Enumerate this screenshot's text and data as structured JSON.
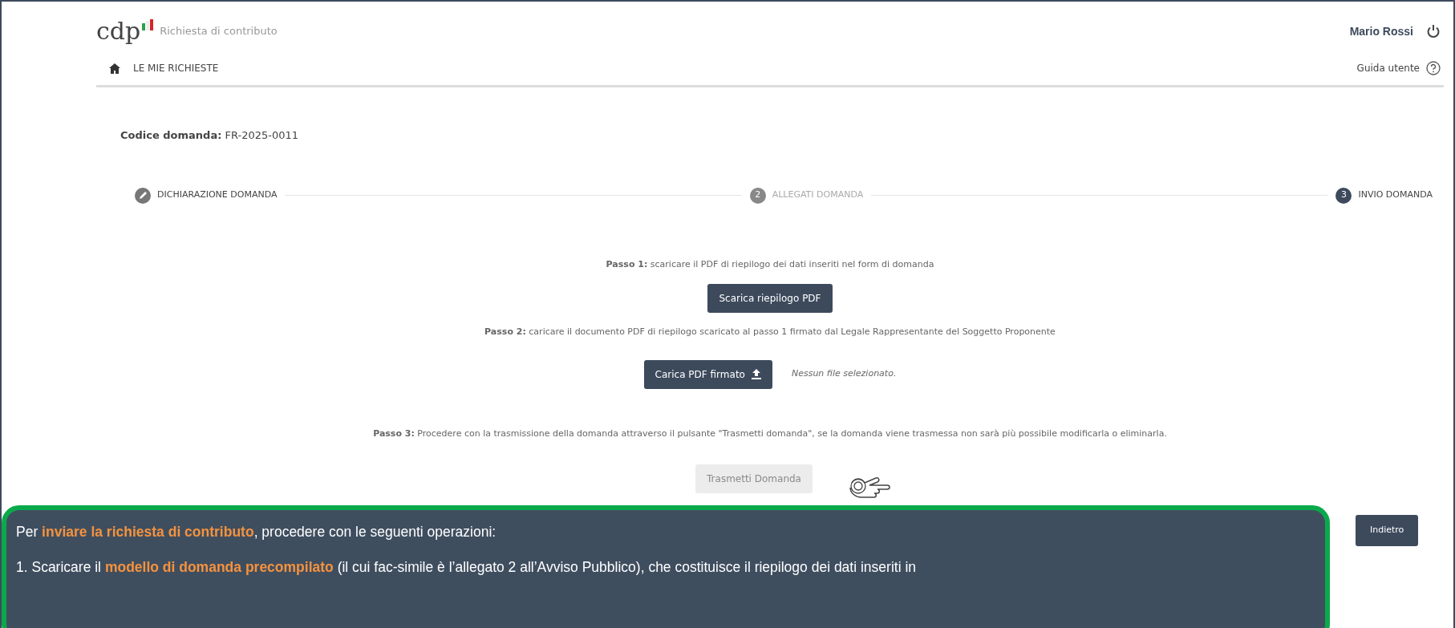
{
  "header": {
    "logo": "cdp",
    "app_title": "Richiesta di contributo",
    "user_name": "Mario Rossi"
  },
  "nav": {
    "home_link": "LE MIE RICHIESTE",
    "help_link": "Guida utente"
  },
  "application_code": "**Codice domanda:** FR-2025-0011",
  "steps": [
    {
      "label": "DICHIARAZIONE DOMANDA",
      "completed": true,
      "selected": false
    },
    {
      "label": "ALLEGATI DOMANDA",
      "number": "2",
      "completed": false,
      "selected": false
    },
    {
      "label": "INVIO DOMANDA",
      "number": "3",
      "completed": false,
      "selected": true
    }
  ],
  "passo_1": {
    "text": "**Passo 1:** scaricare il PDF di riepilogo dei dati inseriti nel form di domanda",
    "button": "Scarica riepilogo PDF"
  },
  "passo_2": {
    "text": "**Passo 2:** caricare il documento PDF di riepilogo scaricato al passo 1 firmato dal Legale Rappresentante del Soggetto Proponente",
    "button": "Carica PDF firmato",
    "file_status": "Nessun file selezionato."
  },
  "passo_3": {
    "text": "**Passo 3:** Procedere con la trasmissione della domanda attraverso il pulsante \"Trasmetti domanda\", se la domanda viene trasmessa non sarà più possibile modificarla o eliminarla.",
    "button": "Trasmetti Domanda",
    "button_disabled": true
  },
  "back_button": "Indietro",
  "callout": [
    "Per **inviare la richiesta di contributo**, procedere con le seguenti operazioni:",
    "1. Scaricare il **modello di domanda precompilato** (il cui fac-simile è l’allegato 2 all’Avviso Pubblico), che costituisce il riepilogo dei dati inseriti in"
  ]
}
